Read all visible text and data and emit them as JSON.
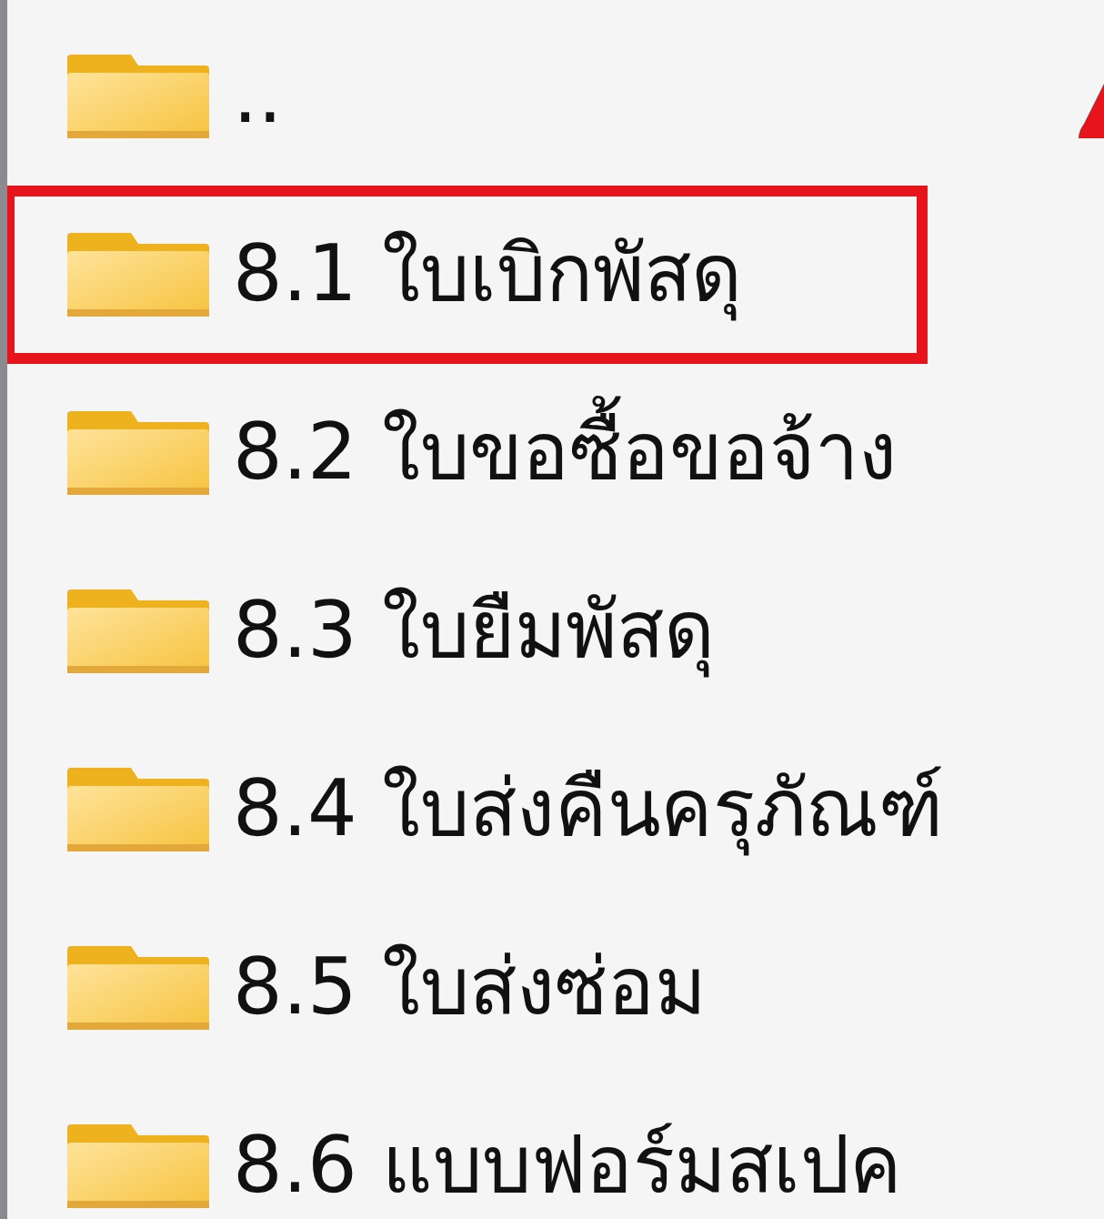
{
  "folders": [
    {
      "name": "..",
      "highlighted": false
    },
    {
      "name": "8.1 ใบเบิกพัสดุ",
      "highlighted": true
    },
    {
      "name": "8.2 ใบขอซื้อขอจ้าง",
      "highlighted": false
    },
    {
      "name": "8.3 ใบยืมพัสดุ",
      "highlighted": false
    },
    {
      "name": "8.4 ใบส่งคืนครุภัณฑ์",
      "highlighted": false
    },
    {
      "name": "8.5 ใบส่งซ่อม",
      "highlighted": false
    },
    {
      "name": "8.6 แบบฟอร์มสเปค",
      "highlighted": false
    }
  ]
}
